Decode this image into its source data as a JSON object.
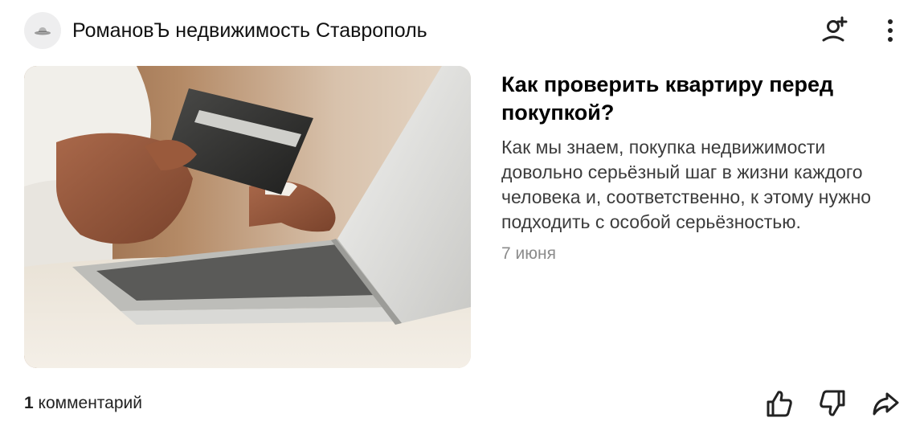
{
  "header": {
    "channel_name": "РомановЪ недвижимость Ставрополь",
    "avatar_icon": "hat-logo-icon",
    "subscribe_icon": "add-user-icon",
    "menu_icon": "more-vertical-icon"
  },
  "article": {
    "title": "Как проверить квартиру перед покупкой?",
    "snippet": "Как мы знаем, покупка недвижимости довольно серьёзный шаг в жизни каждого человека и, соответственно, к этому нужно подходить с особой серьёзностью.",
    "date": "7 июня",
    "image_icon": "article-photo-credit-card-laptop"
  },
  "footer": {
    "comments_count": "1",
    "comments_label": "комментарий",
    "like_icon": "thumbs-up-icon",
    "dislike_icon": "thumbs-down-icon",
    "share_icon": "share-arrow-icon"
  },
  "colors": {
    "title": "#000000",
    "snippet": "#3c3c3c",
    "date": "#8c8c8c",
    "avatar_bg": "#eeeeef"
  }
}
